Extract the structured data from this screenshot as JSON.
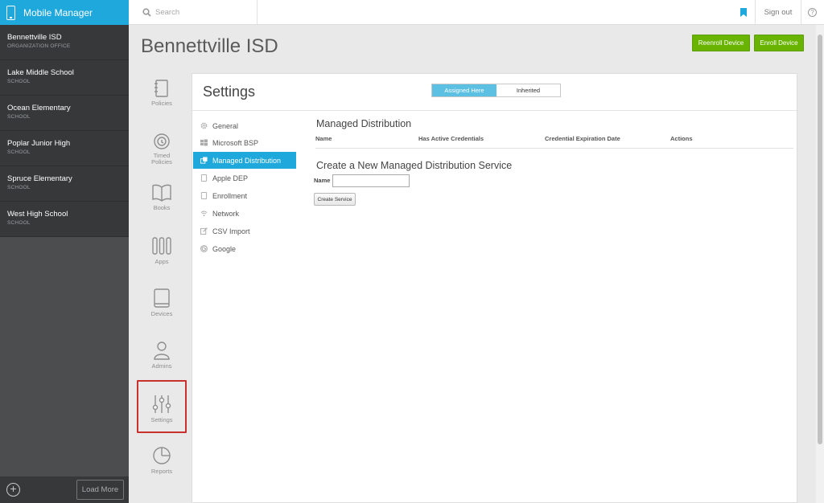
{
  "app": {
    "title": "Mobile Manager"
  },
  "search": {
    "placeholder": "Search"
  },
  "topbar": {
    "signout_label": "Sign out",
    "help_label": "?"
  },
  "orgs": [
    {
      "name": "Bennettville ISD",
      "type": "ORGANIZATION OFFICE"
    },
    {
      "name": "Lake Middle School",
      "type": "SCHOOL"
    },
    {
      "name": "Ocean Elementary",
      "type": "SCHOOL"
    },
    {
      "name": "Poplar Junior High",
      "type": "SCHOOL"
    },
    {
      "name": "Spruce Elementary",
      "type": "SCHOOL"
    },
    {
      "name": "West High School",
      "type": "SCHOOL"
    }
  ],
  "sidebar_footer": {
    "add_label": "+",
    "load_more_label": "Load More"
  },
  "page": {
    "title": "Bennettville ISD",
    "reenroll_label": "Reenroll Device",
    "enroll_label": "Enroll Device"
  },
  "nav": [
    {
      "label": "Policies",
      "icon": "policies-icon"
    },
    {
      "label": "Timed Policies",
      "icon": "timed-policies-icon"
    },
    {
      "label": "Books",
      "icon": "books-icon"
    },
    {
      "label": "Apps",
      "icon": "apps-icon"
    },
    {
      "label": "Devices",
      "icon": "devices-icon"
    },
    {
      "label": "Admins",
      "icon": "admins-icon"
    },
    {
      "label": "Settings",
      "icon": "settings-icon",
      "selected": true
    },
    {
      "label": "Reports",
      "icon": "reports-icon"
    }
  ],
  "settings": {
    "title": "Settings",
    "toggle": {
      "assigned_label": "Assigned Here",
      "inherited_label": "Inherited",
      "selected": "Assigned Here"
    },
    "menu": [
      {
        "label": "General",
        "icon": "gear-icon"
      },
      {
        "label": "Microsoft BSP",
        "icon": "windows-icon"
      },
      {
        "label": "Managed Distribution",
        "icon": "managed-distribution-icon",
        "active": true
      },
      {
        "label": "Apple DEP",
        "icon": "apple-dep-icon"
      },
      {
        "label": "Enrollment",
        "icon": "enrollment-icon"
      },
      {
        "label": "Network",
        "icon": "wifi-icon"
      },
      {
        "label": "CSV Import",
        "icon": "csv-import-icon"
      },
      {
        "label": "Google",
        "icon": "google-icon"
      }
    ],
    "managed_distribution": {
      "title": "Managed Distribution",
      "columns": [
        "Name",
        "Has Active Credentials",
        "Credential Expiration Date",
        "Actions"
      ],
      "create_title": "Create a New Managed Distribution Service",
      "name_label": "Name",
      "name_value": "",
      "create_button_label": "Create Service"
    }
  },
  "colors": {
    "accent": "#1ea8dc",
    "green": "#69b400",
    "highlight": "#c8312d",
    "sidebar": "#363839"
  }
}
